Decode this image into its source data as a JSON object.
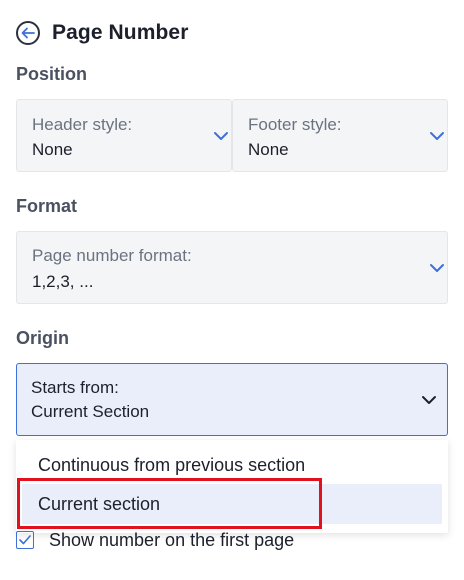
{
  "header": {
    "title": "Page Number",
    "back_icon": "arrow-left-circle-icon"
  },
  "position": {
    "label": "Position",
    "header_style": {
      "label": "Header style:",
      "value": "None"
    },
    "footer_style": {
      "label": "Footer style:",
      "value": "None"
    }
  },
  "format": {
    "label": "Format",
    "page_number_format": {
      "label": "Page number format:",
      "value": "1,2,3, ..."
    }
  },
  "origin": {
    "label": "Origin",
    "starts_from": {
      "label": "Starts from:",
      "value": "Current Section",
      "expanded": true
    },
    "options": [
      {
        "label": "Continuous from previous section",
        "selected": false
      },
      {
        "label": "Current section",
        "selected": true
      }
    ]
  },
  "first_page": {
    "label": "Show number on the first page",
    "checked": true
  },
  "colors": {
    "accent": "#3f6fd8",
    "highlight": "#e0121f",
    "selected_bg": "#e9eefa",
    "field_bg": "#f4f5f7"
  }
}
